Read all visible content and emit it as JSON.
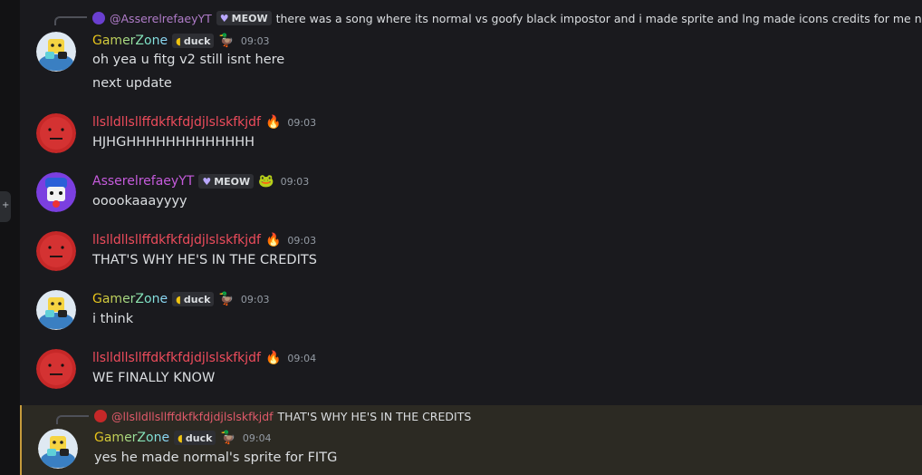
{
  "reply1": {
    "author": "@AsserelrefaeyYT",
    "tag": "MEOW",
    "text": "there was a song where its normal vs goofy black impostor and i made sprite and lng made icons credits for me no .,.?"
  },
  "messages": [
    {
      "author": "GamerZone",
      "tag": "duck",
      "time": "09:03",
      "lines": [
        "oh yea u fitg v2 still isnt here",
        "next update"
      ]
    },
    {
      "author": "llslldllsllffdkfkfdjdjlslskfkjdf",
      "time": "09:03",
      "lines": [
        "HJHGHHHHHHHHHHHHH"
      ]
    },
    {
      "author": "AsserelrefaeyYT",
      "tag": "MEOW",
      "time": "09:03",
      "lines": [
        "ooookaaayyyy"
      ]
    },
    {
      "author": "llslldllsllffdkfkfdjdjlslskfkjdf",
      "time": "09:03",
      "lines": [
        "THAT'S WHY HE'S IN THE CREDITS"
      ]
    },
    {
      "author": "GamerZone",
      "tag": "duck",
      "time": "09:03",
      "lines": [
        "i think"
      ]
    },
    {
      "author": "llslldllsllffdkfkfdjdjlslskfkjdf",
      "time": "09:04",
      "lines": [
        "WE FINALLY KNOW"
      ]
    },
    {
      "author": "GamerZone",
      "tag": "duck",
      "time": "09:04",
      "lines": [
        "yes he made normal's sprite for FITG"
      ]
    }
  ],
  "reply2": {
    "author": "@llslldllsllffdkfkfdjdjlslskfkjdf",
    "text": "THAT'S WHY HE'S IN THE CREDITS"
  },
  "side_tab": "+",
  "colors": {
    "bg": "#1a1a1e",
    "highlight": "#2c2a23",
    "highlight_bar": "#c69b3c",
    "red_user": "#ee4c5c",
    "purple_user": "#c55bdc"
  },
  "icons": {
    "guild_tag": "lemon-icon",
    "duck": "duck-icon",
    "fire": "fire-icon",
    "heart": "heart-icon",
    "frog": "frog-icon"
  }
}
